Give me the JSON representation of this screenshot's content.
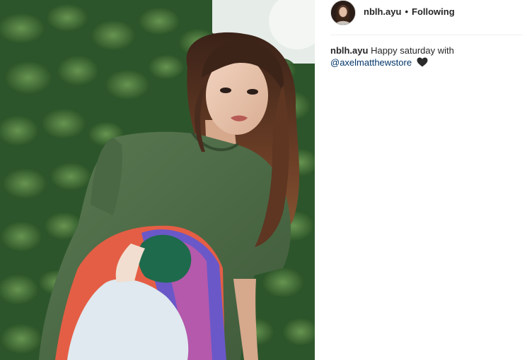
{
  "post": {
    "username": "nblh.ayu",
    "separator": "•",
    "follow_status": "Following"
  },
  "caption": {
    "username": "nblh.ayu",
    "text": "Happy saturday with",
    "mention": "@axelmatthewstore",
    "emoji": "black-heart-icon"
  },
  "photo": {
    "subject": "woman-in-green-tshirt-photo"
  },
  "colors": {
    "text": "#262626",
    "mention": "#003569",
    "divider": "#efefef",
    "shirt": "#4e6b47",
    "foliage": "#2f5a31"
  }
}
